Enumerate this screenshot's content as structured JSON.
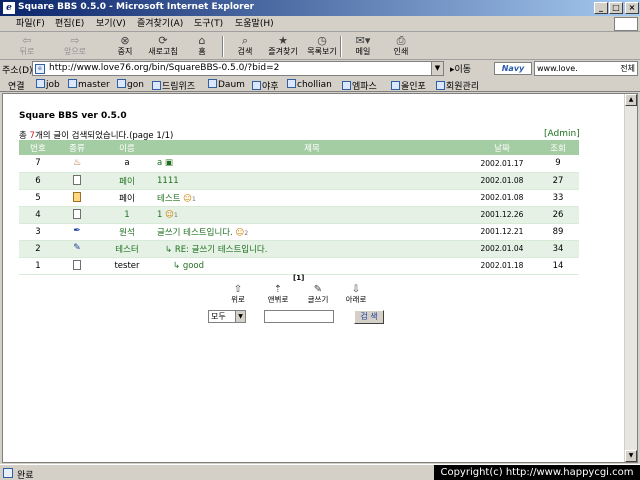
{
  "window": {
    "title": "Square BBS 0.5.0 - Microsoft Internet Explorer",
    "min_glyph": "_",
    "max_glyph": "□",
    "close_glyph": "×"
  },
  "menu": [
    "파일(F)",
    "편집(E)",
    "보기(V)",
    "즐겨찾기(A)",
    "도구(T)",
    "도움말(H)"
  ],
  "toolbar": {
    "back": "뒤로",
    "forward": "앞으로",
    "stop": "중지",
    "refresh": "새로고침",
    "home": "홈",
    "search": "검색",
    "favorites": "즐겨찾기",
    "history": "목록보기",
    "mail": "메일",
    "print": "인쇄"
  },
  "address": {
    "label": "주소(D)",
    "url": "http://www.love76.org/bin/SquareBBS-0.5.0/?bid=2",
    "go": "이동",
    "navy_logo": "Navy",
    "navy_search_value": "www.love.",
    "navy_search_all": "전체"
  },
  "links": {
    "label": "연결",
    "items": [
      "job",
      "master",
      "gon",
      "드림위즈",
      "Daum",
      "야후",
      "chollian",
      "엠파스",
      "올인포",
      "회원관리"
    ]
  },
  "page": {
    "title": "Square BBS ver 0.5.0",
    "count_prefix": "총 ",
    "count_num": "7",
    "count_suffix": "개의 글이 검색되었습니다.(page 1/1)",
    "admin_link": "[Admin]",
    "columns": [
      "번호",
      "종류",
      "이름",
      "제목",
      "날짜",
      "조회"
    ],
    "rows": [
      {
        "no": "7",
        "type": "cake",
        "name": "a",
        "subject": "a",
        "date": "2002.01.17",
        "views": "9"
      },
      {
        "no": "6",
        "type": "doc",
        "name": "페이",
        "subject": "1111",
        "date": "2002.01.08",
        "views": "27"
      },
      {
        "no": "5",
        "type": "img",
        "name": "페이",
        "subject": "테스트",
        "comments": "1",
        "date": "2002.01.08",
        "views": "33"
      },
      {
        "no": "4",
        "type": "doc",
        "name": "1",
        "subject": "1",
        "comments": "1",
        "date": "2001.12.26",
        "views": "26"
      },
      {
        "no": "3",
        "type": "pen",
        "name": "원석",
        "subject": "글쓰기 테스트입니다.",
        "comments": "2",
        "date": "2001.12.21",
        "views": "89"
      },
      {
        "no": "2",
        "type": "pen",
        "name": "테스터",
        "subject": "RE: 글쓰기 테스트입니다.",
        "reply": true,
        "date": "2002.01.04",
        "views": "34"
      },
      {
        "no": "1",
        "type": "doc",
        "name": "tester",
        "subject": "good",
        "reply": true,
        "date": "2002.01.18",
        "views": "14"
      }
    ],
    "page_indicator": "[1]",
    "nav": {
      "prev": "위로",
      "list": "앤뷔로",
      "write": "글쓰기",
      "next": "아래로"
    },
    "search_select": "모두",
    "search_button": "검 색"
  },
  "status": {
    "text": "완료",
    "copyright": "Copyright(c) http://www.happycgi.com"
  }
}
